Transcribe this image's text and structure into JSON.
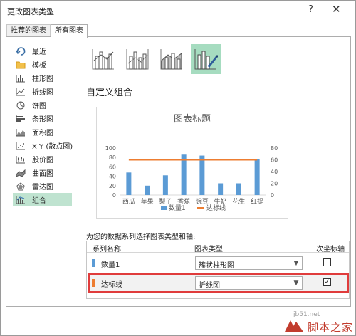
{
  "window": {
    "title": "更改图表类型",
    "help_icon": "?",
    "close_icon": "✕"
  },
  "tabs": [
    {
      "label": "推荐的图表",
      "active": false
    },
    {
      "label": "所有图表",
      "active": true
    }
  ],
  "sidebar": {
    "items": [
      {
        "label": "最近",
        "icon": "recent-icon"
      },
      {
        "label": "模板",
        "icon": "folder-icon"
      },
      {
        "label": "柱形图",
        "icon": "column-chart-icon"
      },
      {
        "label": "折线图",
        "icon": "line-chart-icon"
      },
      {
        "label": "饼图",
        "icon": "pie-chart-icon"
      },
      {
        "label": "条形图",
        "icon": "bar-chart-icon"
      },
      {
        "label": "面积图",
        "icon": "area-chart-icon"
      },
      {
        "label": "X Y (散点图)",
        "icon": "scatter-chart-icon"
      },
      {
        "label": "股价图",
        "icon": "stock-chart-icon"
      },
      {
        "label": "曲面图",
        "icon": "surface-chart-icon"
      },
      {
        "label": "雷达图",
        "icon": "radar-chart-icon"
      },
      {
        "label": "组合",
        "icon": "combo-chart-icon",
        "selected": true
      }
    ]
  },
  "main": {
    "section_title": "自定义组合",
    "assign_label": "为您的数据系列选择图表类型和轴:",
    "columns": {
      "series_name": "系列名称",
      "chart_type": "图表类型",
      "secondary_axis": "次坐标轴"
    },
    "series_rows": [
      {
        "name": "数量1",
        "chart_type": "簇状柱形图",
        "secondary_axis": false,
        "color": "#5b9bd5"
      },
      {
        "name": "达标线",
        "chart_type": "折线图",
        "secondary_axis": true,
        "color": "#ed7d31",
        "highlighted": true
      }
    ]
  },
  "chart_data": {
    "type": "bar",
    "title": "图表标题",
    "categories": [
      "西瓜",
      "苹果",
      "梨子",
      "香蕉",
      "豌豆",
      "牛奶",
      "花生",
      "红提"
    ],
    "series": [
      {
        "name": "数量1",
        "type": "bar",
        "axis": "primary",
        "color": "#5b9bd5",
        "values": [
          48,
          20,
          42,
          86,
          84,
          25,
          25,
          76
        ]
      },
      {
        "name": "达标线",
        "type": "line",
        "axis": "secondary",
        "color": "#ed7d31",
        "values": [
          60,
          60,
          60,
          60,
          60,
          60,
          60,
          60
        ]
      }
    ],
    "y_ticks": [
      "0",
      "20",
      "40",
      "60",
      "80",
      "100"
    ],
    "y2_ticks": [
      "0",
      "20",
      "40",
      "60",
      "80"
    ],
    "ylim": [
      0,
      100
    ],
    "y2lim": [
      0,
      80
    ],
    "grid": false,
    "legend": "bottom"
  },
  "watermark": {
    "site": "jb51.net",
    "brand": "脚本之家"
  }
}
